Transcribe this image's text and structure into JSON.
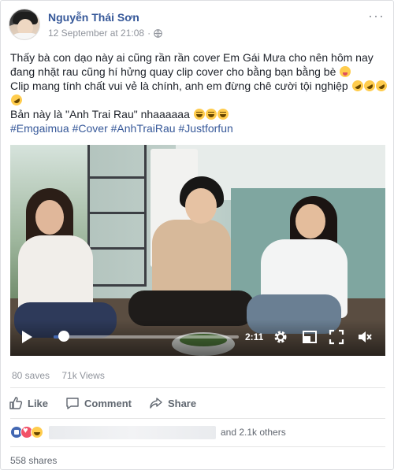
{
  "post": {
    "author": "Nguyễn Thái Sơn",
    "timestamp": "12 September at 21:08",
    "privacy_icon": "globe-icon",
    "more_icon": "more-options-icon",
    "text_lines": [
      "Thấy bà con dạo này ai cũng rần rần cover Em Gái Mưa cho nên hôm nay đang nhặt rau cũng hí hửng quay clip cover cho bằng bạn bằng bè",
      "Clip mang tính chất vui vẻ là chính, anh em đừng chê cười tội nghiệp",
      "Bản này là \"Anh Trai Rau\" nhaaaaaa"
    ],
    "hashtags": [
      "#Emgaimua",
      "#Cover",
      "#AnhTraiRau",
      "#Justforfun"
    ]
  },
  "video": {
    "elapsed": "2:11",
    "progress": 0.05,
    "controls": [
      "play-icon",
      "gear-icon",
      "pip-icon",
      "expand-icon",
      "mute-icon"
    ]
  },
  "stats": {
    "saves": "80 saves",
    "views": "71k Views"
  },
  "actions": {
    "like": "Like",
    "comment": "Comment",
    "share": "Share"
  },
  "reactions": {
    "others": "and 2.1k others"
  },
  "shares": "558 shares",
  "colors": {
    "link_blue": "#365899",
    "accent": "#4267b2",
    "meta_gray": "#90949c"
  }
}
